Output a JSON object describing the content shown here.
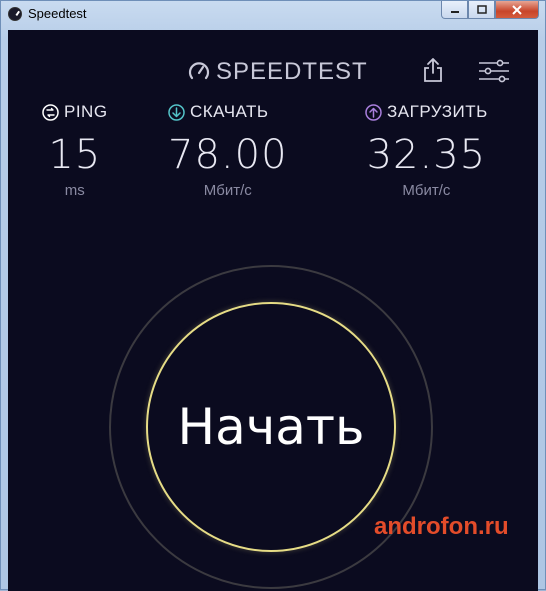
{
  "window": {
    "title": "Speedtest",
    "min_label": "▭",
    "max_label": "▢",
    "close_label": "✕"
  },
  "header": {
    "logo_text": "SPEEDTEST"
  },
  "metrics": [
    {
      "label": "PING",
      "value": "15",
      "unit": "ms",
      "icon": "ping-icon",
      "color": "#ffffff"
    },
    {
      "label": "СКАЧАТЬ",
      "value": "78.00",
      "unit": "Мбит/с",
      "icon": "download-arrow-icon",
      "color": "#54c4c9"
    },
    {
      "label": "ЗАГРУЗИТЬ",
      "value": "32.35",
      "unit": "Мбит/с",
      "icon": "upload-arrow-icon",
      "color": "#a97fdd"
    }
  ],
  "start_button": {
    "label": "Начать"
  },
  "watermark": "androfon.ru"
}
